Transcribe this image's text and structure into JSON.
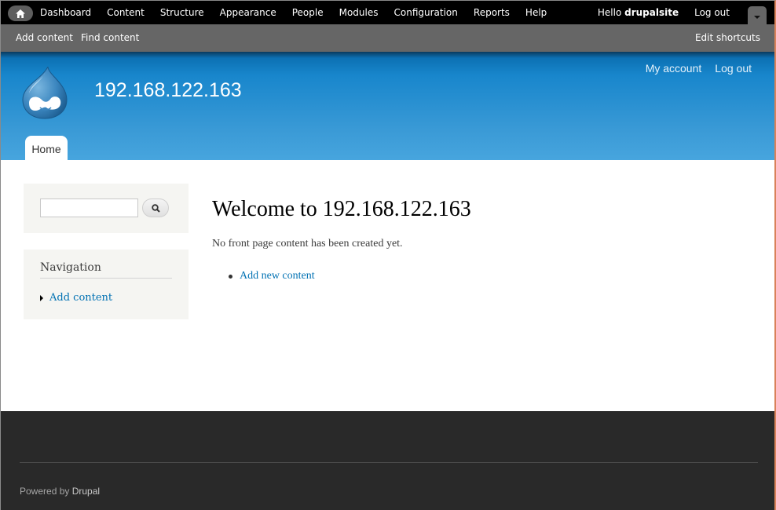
{
  "toolbar": {
    "home_icon": "home-icon",
    "menu": [
      {
        "label": "Dashboard"
      },
      {
        "label": "Content"
      },
      {
        "label": "Structure"
      },
      {
        "label": "Appearance"
      },
      {
        "label": "People"
      },
      {
        "label": "Modules"
      },
      {
        "label": "Configuration"
      },
      {
        "label": "Reports"
      },
      {
        "label": "Help"
      }
    ],
    "hello_prefix": "Hello ",
    "username": "drupalsite",
    "logout_label": "Log out",
    "drawer_icon": "chevron-down-icon"
  },
  "shortcuts": {
    "items": [
      {
        "label": "Add content"
      },
      {
        "label": "Find content"
      }
    ],
    "edit_label": "Edit shortcuts"
  },
  "header": {
    "logo": "drupal-drop-logo",
    "site_name": "192.168.122.163",
    "secondary_menu": [
      {
        "label": "My account"
      },
      {
        "label": "Log out"
      }
    ],
    "main_menu": [
      {
        "label": "Home",
        "active": true
      }
    ]
  },
  "sidebar": {
    "search": {
      "value": "",
      "placeholder": "",
      "button_icon": "search-icon"
    },
    "navigation": {
      "title": "Navigation",
      "items": [
        {
          "label": "Add content"
        }
      ]
    }
  },
  "content": {
    "title": "Welcome to 192.168.122.163",
    "empty_message": "No front page content has been created yet.",
    "links": [
      {
        "label": "Add new content"
      }
    ]
  },
  "footer": {
    "powered_by_prefix": "Powered by ",
    "powered_by_link": "Drupal"
  },
  "colors": {
    "toolbar_bg": "#000000",
    "shortcuts_bg": "#666666",
    "header_blue": "#1886cc",
    "link": "#0071b3",
    "footer_bg": "#292929"
  }
}
